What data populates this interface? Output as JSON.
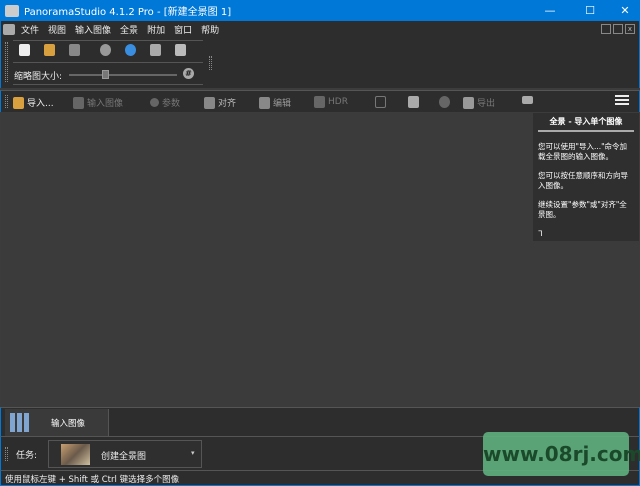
{
  "window": {
    "title": "PanoramaStudio 4.1.2 Pro - [新建全景图 1]",
    "minimize": "—",
    "maximize": "☐",
    "close": "✕"
  },
  "menu": [
    "文件",
    "视图",
    "输入图像",
    "全景",
    "附加",
    "窗口",
    "帮助"
  ],
  "toolbar1": {
    "thumb_label": "缩略图大小:",
    "thumb_value": 0.55,
    "hash_label": "#"
  },
  "toolbar2": {
    "import": "导入...",
    "input_images": "输入图像",
    "params": "参数",
    "align": "对齐",
    "edit": "编辑",
    "hdr": "HDR",
    "export": "导出"
  },
  "help": {
    "title": "全景 - 导入单个图像",
    "p1": "您可以使用\"导入...\"命令加载全景图的输入图像。",
    "p2": "您可以按任意顺序和方向导入图像。",
    "p3": "继续设置\"参数\"或\"对齐\"全景图。",
    "corner": "ᒣ"
  },
  "tabs": {
    "input_images": "输入图像"
  },
  "task": {
    "label": "任务:",
    "value": "创建全景图"
  },
  "status": "使用鼠标左键 + Shift 或 Ctrl 键选择多个图像",
  "watermark": "www.08rj.com"
}
